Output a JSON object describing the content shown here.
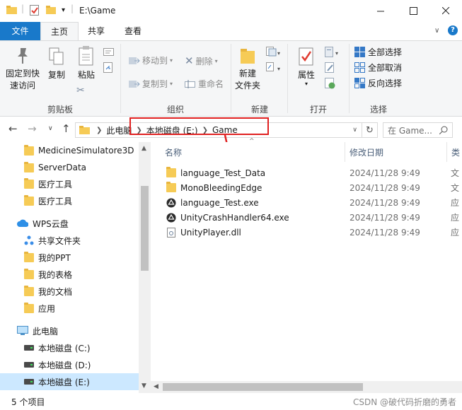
{
  "window": {
    "title": "E:\\Game"
  },
  "tabs": [
    "文件",
    "主页",
    "共享",
    "查看"
  ],
  "ribbon": {
    "clipboard": {
      "pin_label_1": "固定到快",
      "pin_label_2": "速访问",
      "copy": "复制",
      "paste": "粘贴",
      "group": "剪贴板"
    },
    "organize": {
      "move_to": "移动到",
      "copy_to": "复制到",
      "delete": "删除",
      "rename": "重命名",
      "group": "组织"
    },
    "new": {
      "new_folder_1": "新建",
      "new_folder_2": "文件夹",
      "group": "新建"
    },
    "open": {
      "properties": "属性",
      "group": "打开"
    },
    "select": {
      "select_all": "全部选择",
      "select_none": "全部取消",
      "invert": "反向选择",
      "group": "选择"
    }
  },
  "address": {
    "crumbs": [
      "此电脑",
      "本地磁盘 (E:)",
      "Game"
    ],
    "search_placeholder": "在 Game..."
  },
  "navpane": {
    "items": [
      {
        "label": "MedicineSimulatore3D",
        "icon": "folder"
      },
      {
        "label": "ServerData",
        "icon": "folder"
      },
      {
        "label": "医疗工具",
        "icon": "folder"
      },
      {
        "label": "医疗工具",
        "icon": "folder"
      },
      {
        "label": "WPS云盘",
        "icon": "cloud"
      },
      {
        "label": "共享文件夹",
        "icon": "share"
      },
      {
        "label": "我的PPT",
        "icon": "folder"
      },
      {
        "label": "我的表格",
        "icon": "folder"
      },
      {
        "label": "我的文档",
        "icon": "folder"
      },
      {
        "label": "应用",
        "icon": "folder"
      },
      {
        "label": "此电脑",
        "icon": "pc"
      },
      {
        "label": "本地磁盘 (C:)",
        "icon": "drive"
      },
      {
        "label": "本地磁盘 (D:)",
        "icon": "drive"
      },
      {
        "label": "本地磁盘 (E:)",
        "icon": "drive"
      }
    ]
  },
  "filelist": {
    "headers": {
      "name": "名称",
      "date": "修改日期",
      "type": "类"
    },
    "files": [
      {
        "name": "language_Test_Data",
        "date": "2024/11/28 9:49",
        "type": "文",
        "icon": "folder"
      },
      {
        "name": "MonoBleedingEdge",
        "date": "2024/11/28 9:49",
        "type": "文",
        "icon": "folder"
      },
      {
        "name": "language_Test.exe",
        "date": "2024/11/28 9:49",
        "type": "应",
        "icon": "unity"
      },
      {
        "name": "UnityCrashHandler64.exe",
        "date": "2024/11/28 9:49",
        "type": "应",
        "icon": "unity"
      },
      {
        "name": "UnityPlayer.dll",
        "date": "2024/11/28 9:49",
        "type": "应",
        "icon": "dll"
      }
    ]
  },
  "status": {
    "count": "5 个项目",
    "watermark": "CSDN @破代码折磨的勇者"
  },
  "colors": {
    "accent": "#1979ca",
    "selection": "#cce8ff",
    "highlight": "#e02020",
    "folder": "#f6cb56"
  }
}
